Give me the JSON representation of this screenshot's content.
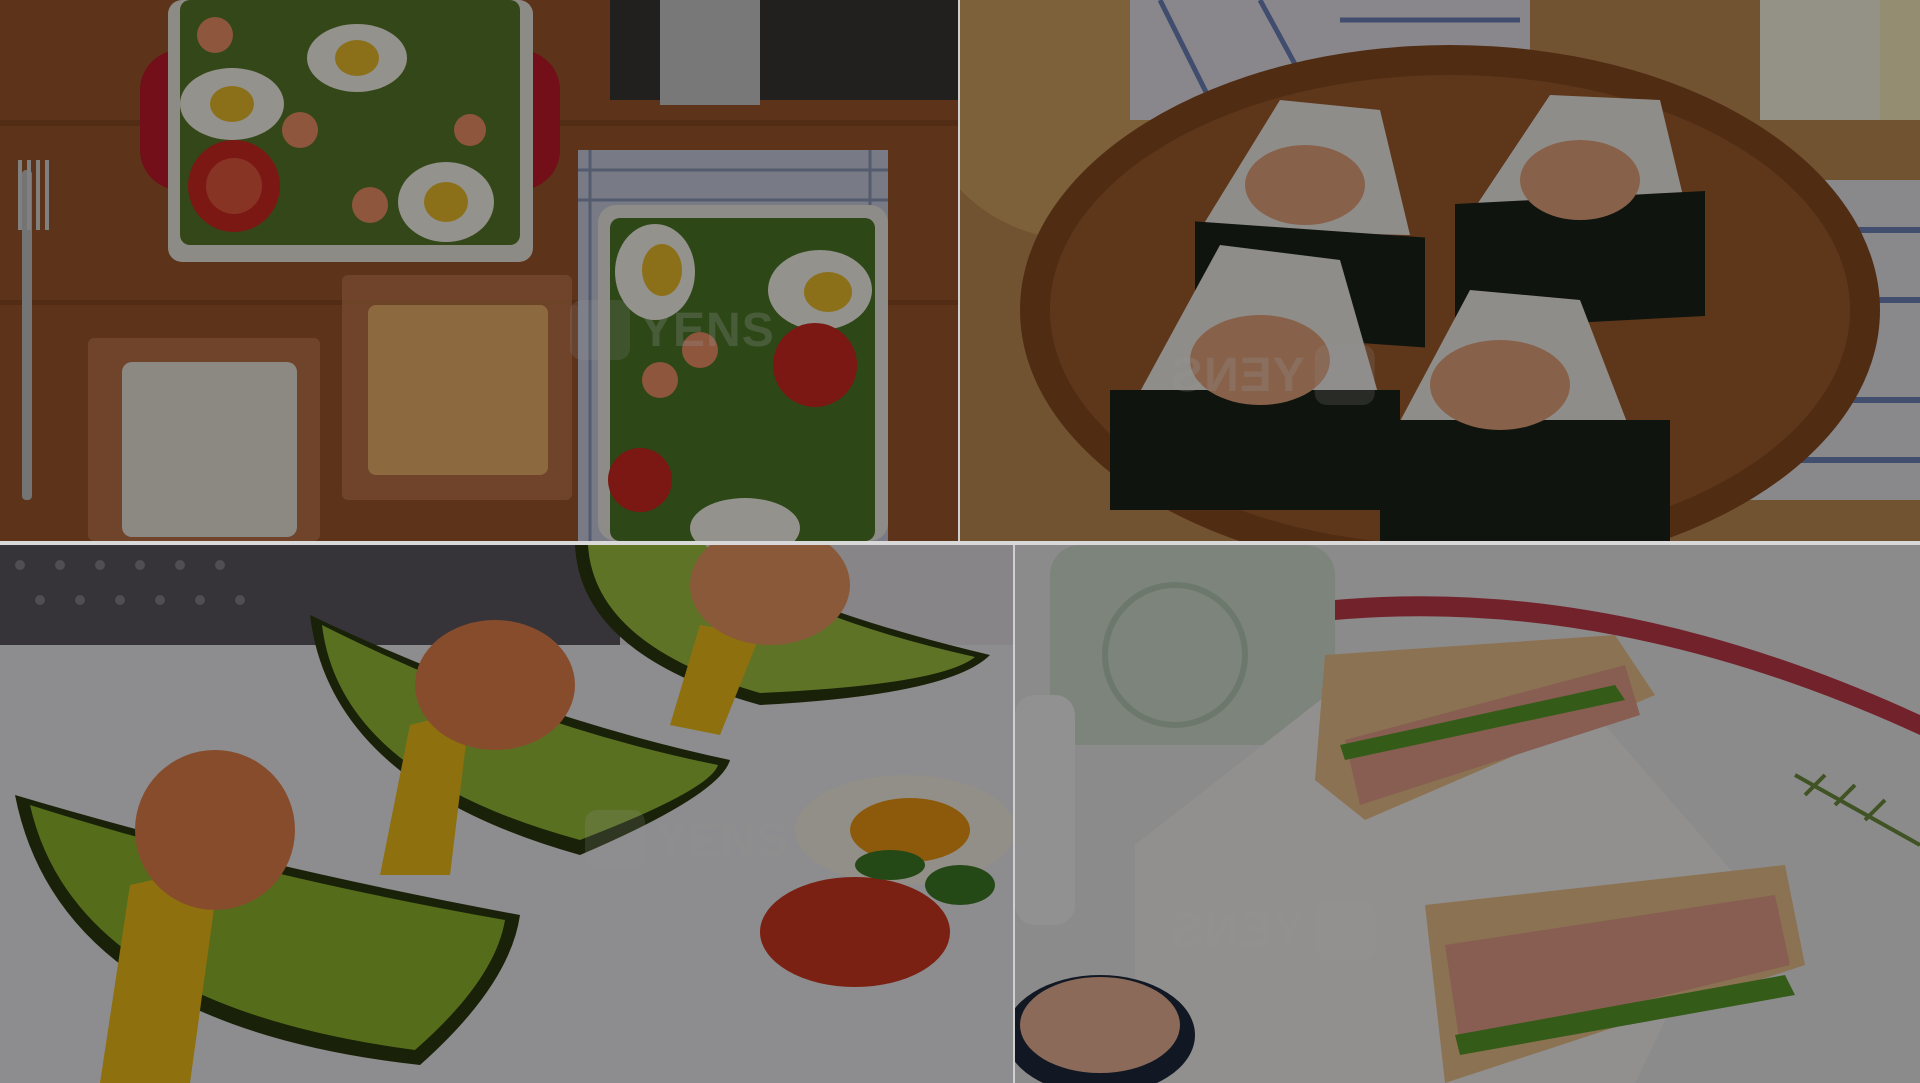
{
  "watermark": {
    "brand": "YENS",
    "brand_mirrored": "YENS"
  },
  "tiles": [
    {
      "name": "salad-lunchbox-photo"
    },
    {
      "name": "onigiri-plate-photo"
    },
    {
      "name": "avocado-shrimp-photo"
    },
    {
      "name": "crab-sandwich-photo"
    }
  ]
}
